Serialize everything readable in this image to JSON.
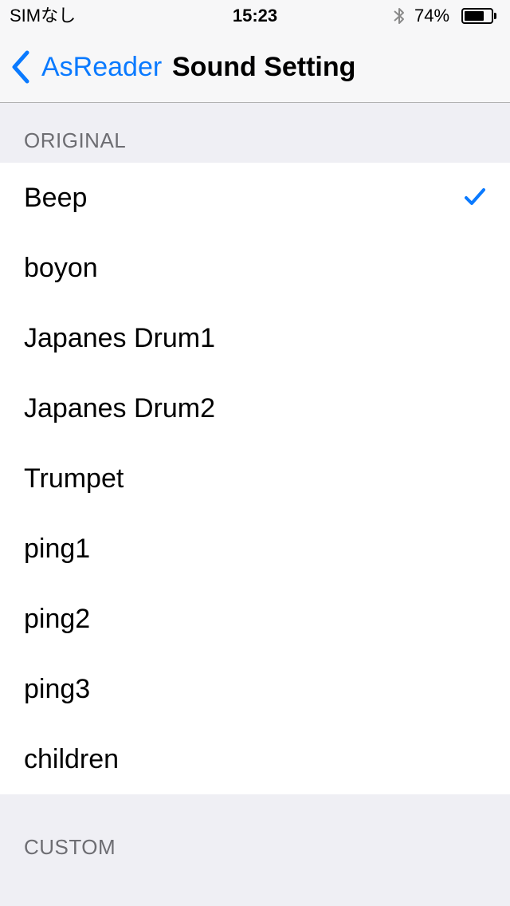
{
  "status_bar": {
    "carrier": "SIMなし",
    "time": "15:23",
    "battery_percent": "74%",
    "battery_level": 0.74,
    "bluetooth_icon": "bluetooth-icon"
  },
  "nav": {
    "back_label": "AsReader",
    "title": "Sound Setting"
  },
  "sections": {
    "original": "ORIGINAL",
    "custom": "CUSTOM"
  },
  "sounds": [
    {
      "label": "Beep",
      "selected": true
    },
    {
      "label": "boyon",
      "selected": false
    },
    {
      "label": "Japanes Drum1",
      "selected": false
    },
    {
      "label": "Japanes Drum2",
      "selected": false
    },
    {
      "label": "Trumpet",
      "selected": false
    },
    {
      "label": "ping1",
      "selected": false
    },
    {
      "label": "ping2",
      "selected": false
    },
    {
      "label": "ping3",
      "selected": false
    },
    {
      "label": "children",
      "selected": false
    }
  ],
  "colors": {
    "accent": "#0a7aff",
    "background": "#efeff4"
  }
}
